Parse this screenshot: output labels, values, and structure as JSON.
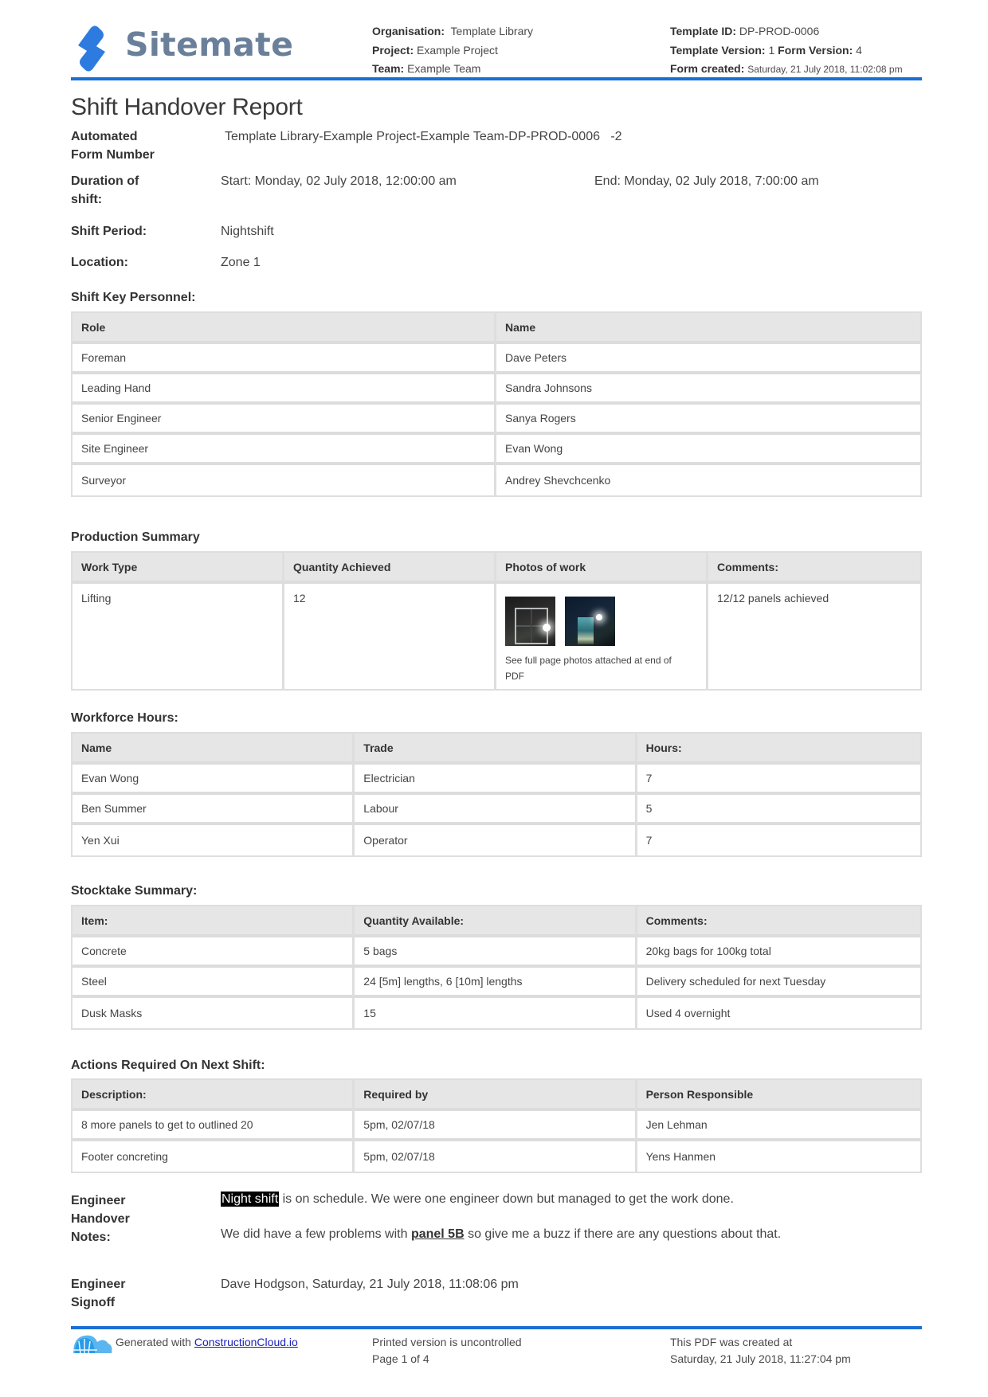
{
  "header": {
    "brand": "Sitemate",
    "logo_icon": "sitemate-s-logo-icon",
    "organisation_label": "Organisation:",
    "organisation": "Template Library",
    "project_label": "Project:",
    "project": "Example Project",
    "team_label": "Team:",
    "team": "Example Team",
    "template_id_label": "Template ID:",
    "template_id": "DP-PROD-0006",
    "template_version_label": "Template Version:",
    "template_version": "1",
    "form_version_label": "Form Version:",
    "form_version": "4",
    "form_created_label": "Form created:",
    "form_created": "Saturday, 21 July 2018, 11:02:08 pm"
  },
  "title": "Shift Handover Report",
  "fields": {
    "form_number_label_1": "Automated",
    "form_number_label_2": "Form Number",
    "form_number": "Template Library-Example Project-Example Team-DP-PROD-0006   -2",
    "duration_label_1": "Duration of",
    "duration_label_2": "shift:",
    "start": "Start: Monday, 02 July 2018, 12:00:00 am",
    "end": "End: Monday, 02 July 2018, 7:00:00 am",
    "shift_period_label": "Shift Period:",
    "shift_period": "Nightshift",
    "location_label": "Location:",
    "location": "Zone 1"
  },
  "personnel": {
    "label": "Shift Key Personnel:",
    "columns": [
      "Role",
      "Name"
    ],
    "rows": [
      [
        "Foreman",
        "Dave Peters"
      ],
      [
        "Leading Hand",
        "Sandra Johnsons"
      ],
      [
        "Senior Engineer",
        "Sanya Rogers"
      ],
      [
        "Site Engineer",
        "Evan Wong"
      ],
      [
        "Surveyor",
        "Andrey Shevchcenko"
      ]
    ]
  },
  "production": {
    "label": "Production Summary",
    "columns": [
      "Work Type",
      "Quantity Achieved",
      "Photos of work",
      "Comments:"
    ],
    "rows": [
      {
        "work_type": "Lifting",
        "quantity": "12",
        "photo_caption": "See full page photos attached at end of PDF",
        "comments": "12/12 panels achieved"
      }
    ]
  },
  "workforce": {
    "label": "Workforce Hours:",
    "columns": [
      "Name",
      "Trade",
      "Hours:"
    ],
    "rows": [
      [
        "Evan Wong",
        "Electrician",
        "7"
      ],
      [
        "Ben Summer",
        "Labour",
        "5"
      ],
      [
        "Yen Xui",
        "Operator",
        "7"
      ]
    ]
  },
  "stocktake": {
    "label": "Stocktake Summary:",
    "columns": [
      "Item:",
      "Quantity Available:",
      "Comments:"
    ],
    "rows": [
      [
        "Concrete",
        "5 bags",
        "20kg bags for 100kg total"
      ],
      [
        "Steel",
        "24 [5m] lengths, 6 [10m] lengths",
        "Delivery scheduled for next Tuesday"
      ],
      [
        "Dusk Masks",
        "15",
        "Used 4 overnight"
      ]
    ]
  },
  "actions": {
    "label": "Actions Required On Next Shift:",
    "columns": [
      "Description:",
      "Required by",
      "Person Responsible"
    ],
    "rows": [
      [
        "8 more panels to get to outlined 20",
        "5pm, 02/07/18",
        "Jen Lehman"
      ],
      [
        "Footer concreting",
        "5pm, 02/07/18",
        "Yens Hanmen"
      ]
    ]
  },
  "notes": {
    "label_1": "Engineer",
    "label_2": "Handover",
    "label_3": "Notes:",
    "line1_highlight": "Night shift",
    "line1_rest": " is on schedule. We were one engineer down but managed to get the work done.",
    "line2_before": "We did have a few problems with ",
    "line2_bold": "panel 5B",
    "line2_after": " so give me a buzz if there are any questions about that."
  },
  "signoff": {
    "label_1": "Engineer",
    "label_2": "Signoff",
    "value": "Dave Hodgson, Saturday, 21 July 2018, 11:08:06 pm"
  },
  "footer": {
    "generated_prefix": "Generated with ",
    "generated_link": "ConstructionCloud.io",
    "cloud_icon": "construction-cloud-icon",
    "uncontrolled": "Printed version is uncontrolled",
    "page": "Page 1 of 4",
    "created_label": "This PDF was created at",
    "created_at": "Saturday, 21 July 2018, 11:27:04 pm"
  },
  "colors": {
    "accent_blue": "#1a6fd6",
    "brand_gray": "#6a809a",
    "table_header_bg": "#e6e6e6",
    "link": "#1a22b8"
  }
}
